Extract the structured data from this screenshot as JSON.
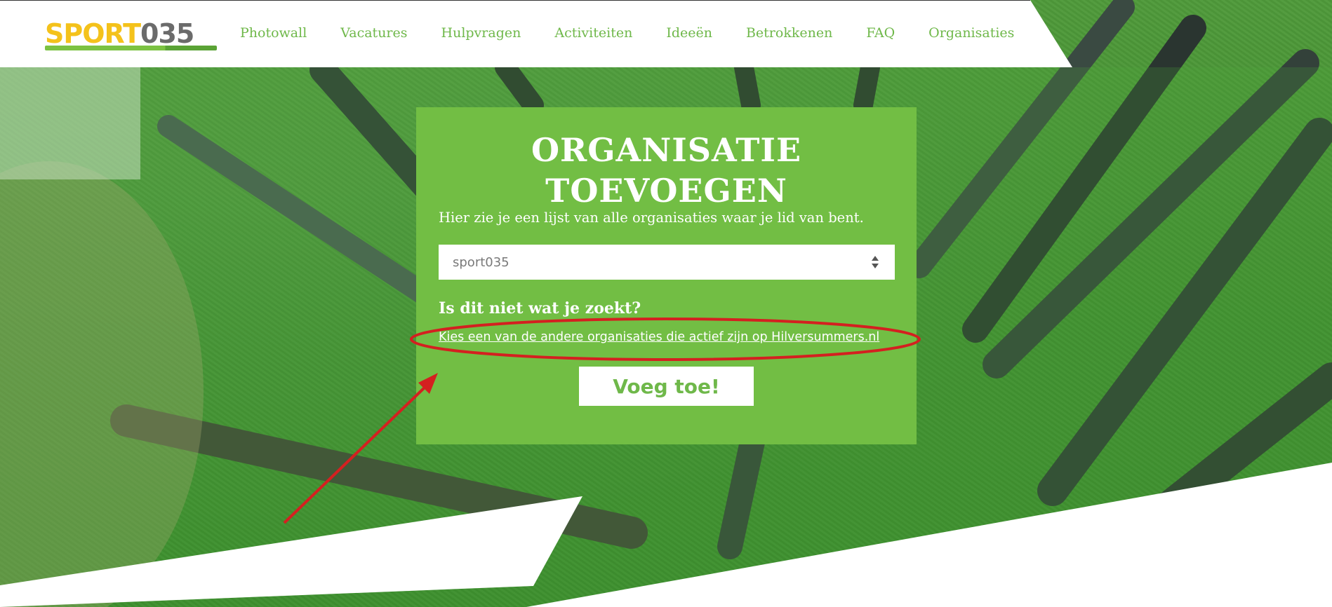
{
  "brand": {
    "logo_sport": "SPORT",
    "logo_num": "035",
    "colors": {
      "green": "#72be44",
      "nav_text": "#6fb84a",
      "logo_yellow": "#f4c21b",
      "logo_grey": "#6b6b6b"
    }
  },
  "nav": {
    "items": [
      {
        "label": "Photowall"
      },
      {
        "label": "Vacatures"
      },
      {
        "label": "Hulpvragen"
      },
      {
        "label": "Activiteiten"
      },
      {
        "label": "Ideeën"
      },
      {
        "label": "Betrokkenen"
      },
      {
        "label": "FAQ"
      },
      {
        "label": "Organisaties"
      }
    ]
  },
  "card": {
    "title_line1": "ORGANISATIE",
    "title_line2": "TOEVOEGEN",
    "subtitle": "Hier zie je een lijst van alle organisaties waar je lid van bent.",
    "select": {
      "value": "sport035",
      "icon": "sort-arrows-icon"
    },
    "question": "Is dit niet wat je zoekt?",
    "link": "Kies een van de andere organisaties die actief zijn op Hilversummers.nl",
    "button": "Voeg toe!"
  },
  "annotation": {
    "color": "#d42020"
  }
}
